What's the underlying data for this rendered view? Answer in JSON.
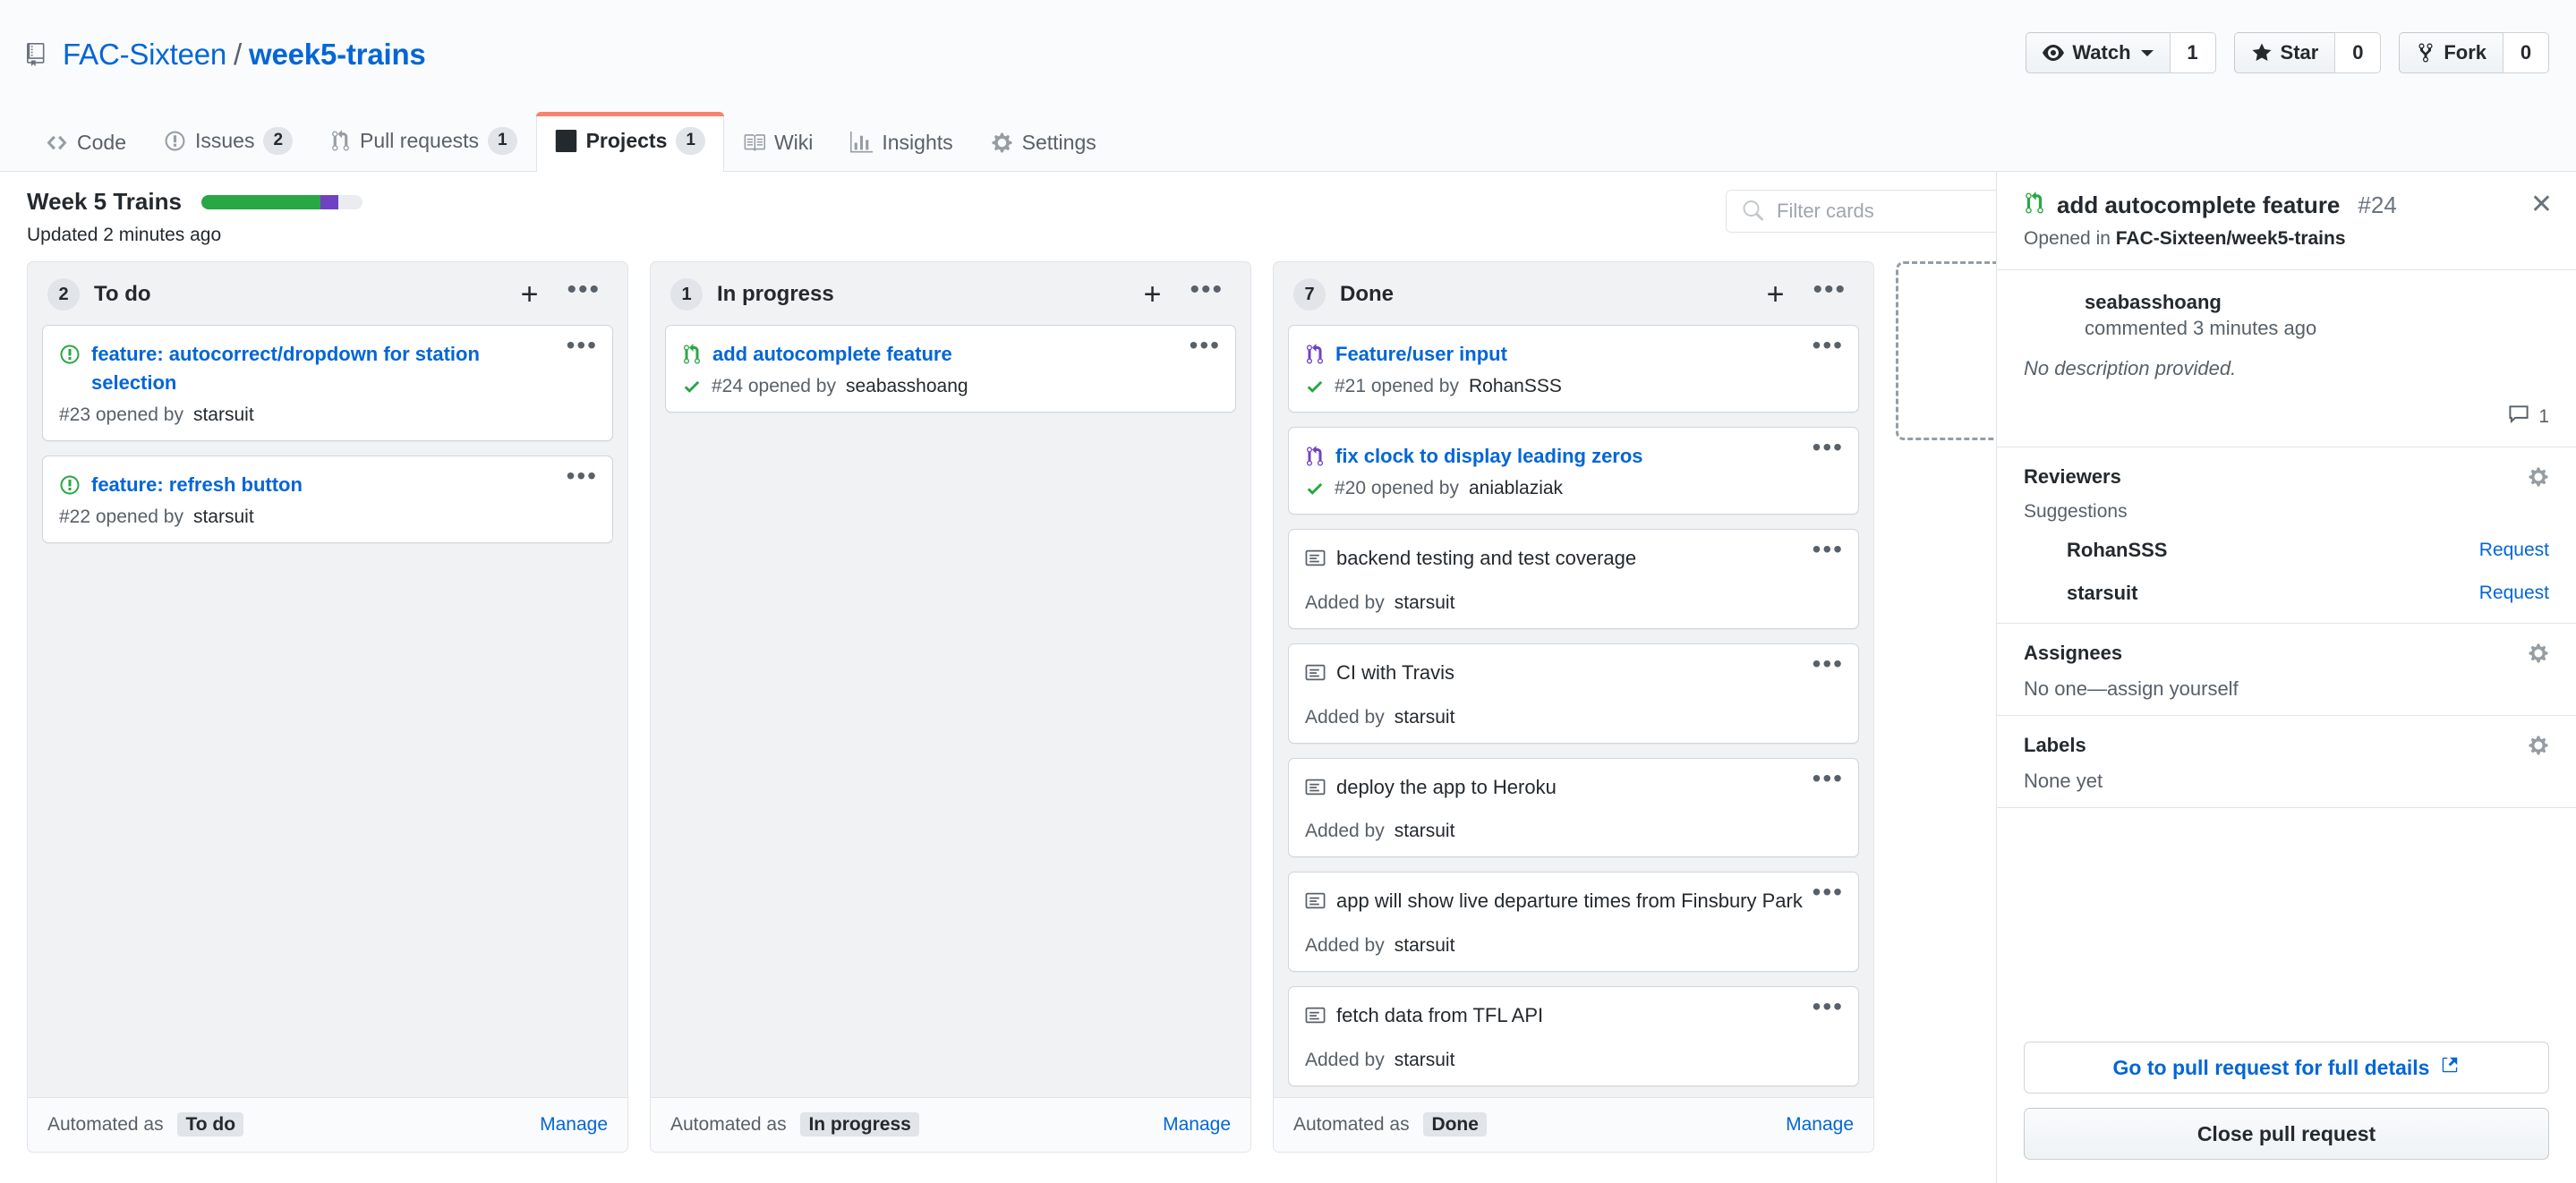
{
  "repo": {
    "icon": "repo-icon",
    "owner": "FAC-Sixteen",
    "separator": "/",
    "name": "week5-trains"
  },
  "repo_actions": [
    {
      "icon": "eye-icon",
      "label": "Watch",
      "count": "1",
      "has_caret": true
    },
    {
      "icon": "star-icon",
      "label": "Star",
      "count": "0",
      "has_caret": false
    },
    {
      "icon": "fork-icon",
      "label": "Fork",
      "count": "0",
      "has_caret": false
    }
  ],
  "nav_tabs": [
    {
      "icon": "code-icon",
      "label": "Code",
      "count": "",
      "selected": false
    },
    {
      "icon": "issue-opened-icon",
      "label": "Issues",
      "count": "2",
      "selected": false
    },
    {
      "icon": "git-pull-request-icon",
      "label": "Pull requests",
      "count": "1",
      "selected": false
    },
    {
      "icon": "project-icon",
      "label": "Projects",
      "count": "1",
      "selected": true
    },
    {
      "icon": "book-icon",
      "label": "Wiki",
      "count": "",
      "selected": false
    },
    {
      "icon": "graph-icon",
      "label": "Insights",
      "count": "",
      "selected": false
    },
    {
      "icon": "gear-icon",
      "label": "Settings",
      "count": "",
      "selected": false
    }
  ],
  "project": {
    "name": "Week 5 Trains",
    "updated": "Updated 2 minutes ago",
    "progress": {
      "green_pct": 74,
      "purple_pct": 11,
      "gray_pct": 15,
      "green_color": "#28a745",
      "purple_color": "#6f42c1",
      "gray_color": "#eaecef"
    }
  },
  "filter": {
    "placeholder": "Filter cards",
    "value": "",
    "icon": "search-icon"
  },
  "columns": [
    {
      "count": "2",
      "name": "To do",
      "add_icon": "plus-icon",
      "menu_icon": "kebab-icon",
      "automated_prefix": "Automated as",
      "automated_state": "To do",
      "manage": "Manage",
      "cards": [
        {
          "type": "issue",
          "icon": "issue-opened-icon",
          "title": "feature: autocorrect/dropdown for station selection",
          "meta_prefix": "#23 opened by",
          "author": "starsuit",
          "has_check": false,
          "avatar": "cat-avatar",
          "menu_icon": "kebab-icon"
        },
        {
          "type": "issue",
          "icon": "issue-opened-icon",
          "title": "feature: refresh button",
          "meta_prefix": "#22 opened by",
          "author": "starsuit",
          "has_check": false,
          "avatar": "star-avatar",
          "menu_icon": "kebab-icon"
        }
      ]
    },
    {
      "count": "1",
      "name": "In progress",
      "add_icon": "plus-icon",
      "menu_icon": "kebab-icon",
      "automated_prefix": "Automated as",
      "automated_state": "In progress",
      "manage": "Manage",
      "cards": [
        {
          "type": "pr-open",
          "icon": "git-pull-request-icon",
          "title": "add autocomplete feature",
          "meta_prefix": "#24 opened by",
          "author": "seabasshoang",
          "has_check": true,
          "avatar": "",
          "menu_icon": "kebab-icon"
        }
      ]
    },
    {
      "count": "7",
      "name": "Done",
      "add_icon": "plus-icon",
      "menu_icon": "kebab-icon",
      "automated_prefix": "Automated as",
      "automated_state": "Done",
      "manage": "Manage",
      "cards": [
        {
          "type": "pr-merged",
          "icon": "git-merge-icon",
          "title": "Feature/user input",
          "meta_prefix": "#21 opened by",
          "author": "RohanSSS",
          "has_check": true,
          "avatar": "",
          "menu_icon": "kebab-icon"
        },
        {
          "type": "pr-merged",
          "icon": "git-merge-icon",
          "title": "fix clock to display leading zeros",
          "meta_prefix": "#20 opened by",
          "author": "aniablaziak",
          "has_check": true,
          "avatar": "",
          "menu_icon": "kebab-icon"
        },
        {
          "type": "note",
          "icon": "note-icon",
          "title": "backend testing and test coverage",
          "meta_prefix": "Added by",
          "author": "starsuit",
          "has_check": false,
          "avatar": "",
          "menu_icon": "kebab-icon"
        },
        {
          "type": "note",
          "icon": "note-icon",
          "title": "CI with Travis",
          "meta_prefix": "Added by",
          "author": "starsuit",
          "has_check": false,
          "avatar": "",
          "menu_icon": "kebab-icon"
        },
        {
          "type": "note",
          "icon": "note-icon",
          "title": "deploy the app to Heroku",
          "meta_prefix": "Added by",
          "author": "starsuit",
          "has_check": false,
          "avatar": "",
          "menu_icon": "kebab-icon"
        },
        {
          "type": "note",
          "icon": "note-icon",
          "title": "app will show live departure times from Finsbury Park",
          "meta_prefix": "Added by",
          "author": "starsuit",
          "has_check": false,
          "avatar": "",
          "menu_icon": "kebab-icon"
        },
        {
          "type": "note",
          "icon": "note-icon",
          "title": "fetch data from TFL API",
          "meta_prefix": "Added by",
          "author": "starsuit",
          "has_check": false,
          "avatar": "",
          "menu_icon": "kebab-icon"
        }
      ]
    }
  ],
  "side_panel": {
    "icon": "git-pull-request-icon",
    "title": "add autocomplete feature",
    "number": "#24",
    "subtitle_prefix": "Opened in",
    "subtitle_repo": "FAC-Sixteen/week5-trains",
    "close_icon": "close-icon",
    "comment": {
      "avatar": "cat-avatar",
      "username": "seabasshoang",
      "timestamp": "commented 3 minutes ago",
      "body": "No description provided.",
      "comment_icon": "comment-icon",
      "comment_count": "1"
    },
    "reviewers": {
      "title": "Reviewers",
      "gear_icon": "gear-icon",
      "suggestions_label": "Suggestions",
      "people": [
        {
          "avatar": "rohan-avatar",
          "name": "RohanSSS",
          "action": "Request"
        },
        {
          "avatar": "star-avatar",
          "name": "starsuit",
          "action": "Request"
        }
      ]
    },
    "assignees": {
      "title": "Assignees",
      "gear_icon": "gear-icon",
      "empty": "No one—assign yourself"
    },
    "labels": {
      "title": "Labels",
      "gear_icon": "gear-icon",
      "empty": "None yet"
    },
    "actions": {
      "goto_label": "Go to pull request for full details",
      "goto_icon": "external-link-icon",
      "close_label": "Close pull request"
    }
  }
}
